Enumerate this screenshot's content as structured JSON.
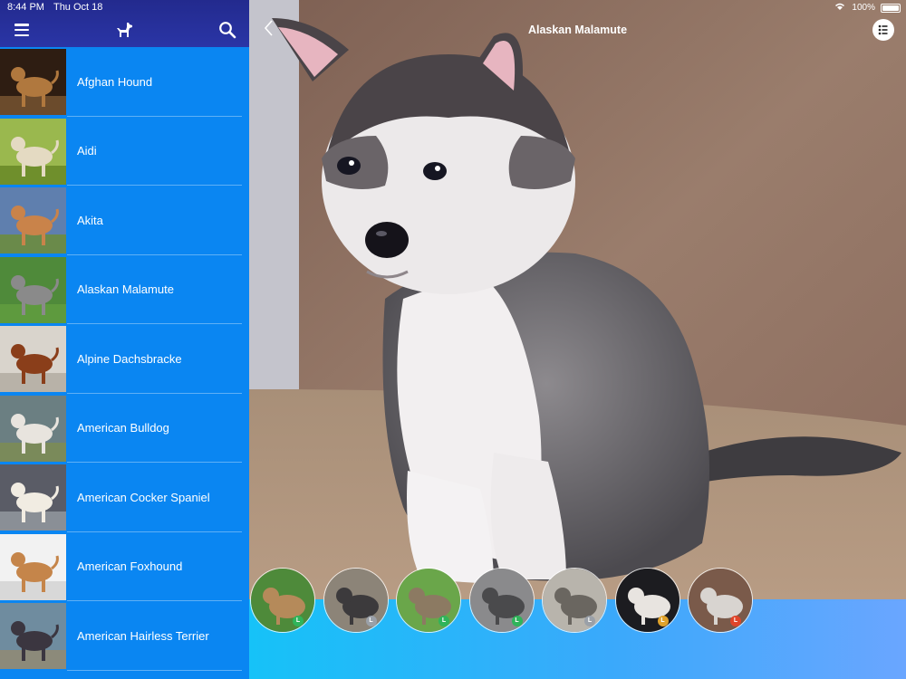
{
  "status": {
    "time": "8:44 PM",
    "date": "Thu Oct 18",
    "battery": "100%"
  },
  "detail": {
    "title": "Alaskan Malamute",
    "back_glyph": "<"
  },
  "breeds": [
    {
      "name": "Afghan Hound",
      "coat": "#b0783e",
      "bg": "#2e1d12",
      "grass": "#6b4b2c"
    },
    {
      "name": "Aidi",
      "coat": "#e4dac2",
      "bg": "#9ab84e",
      "grass": "#6f8f2c"
    },
    {
      "name": "Akita",
      "coat": "#c9834a",
      "bg": "#5f7fae",
      "grass": "#6a8a4a"
    },
    {
      "name": "Alaskan Malamute",
      "coat": "#8a8a8a",
      "bg": "#4f8a3a",
      "grass": "#5e9a3e"
    },
    {
      "name": "Alpine Dachsbracke",
      "coat": "#8a3e1a",
      "bg": "#d9d4cc",
      "grass": "#b8b2a8"
    },
    {
      "name": "American Bulldog",
      "coat": "#e8e4de",
      "bg": "#6b7f82",
      "grass": "#7a8a5a"
    },
    {
      "name": "American Cocker Spaniel",
      "coat": "#f1ece2",
      "bg": "#5a5c66",
      "grass": "#8a8f96"
    },
    {
      "name": "American Foxhound",
      "coat": "#c5854a",
      "bg": "#f2f2f2",
      "grass": "#d8d8d8"
    },
    {
      "name": "American Hairless Terrier",
      "coat": "#3b3640",
      "bg": "#6f8c9f",
      "grass": "#8c8a7a"
    }
  ],
  "gallery": [
    {
      "badge": "L",
      "badge_color": "#2fb45a",
      "bg": "#4e8a3a",
      "fur": "#b58a5a"
    },
    {
      "badge": "L",
      "badge_color": "#9aa0a8",
      "bg": "#8c8478",
      "fur": "#3c3a3c"
    },
    {
      "badge": "L",
      "badge_color": "#2fb45a",
      "bg": "#6aa64a",
      "fur": "#8c7a62"
    },
    {
      "badge": "L",
      "badge_color": "#2fb45a",
      "bg": "#8a8a8c",
      "fur": "#4a4a4c"
    },
    {
      "badge": "L",
      "badge_color": "#9aa0a8",
      "bg": "#b8b4ac",
      "fur": "#6a6660"
    },
    {
      "badge": "L",
      "badge_color": "#e0a22a",
      "bg": "#1c1c20",
      "fur": "#e8e4e0"
    },
    {
      "badge": "L",
      "badge_color": "#e0452a",
      "bg": "#7a5a4a",
      "fur": "#d8d4d0"
    }
  ],
  "colors": {
    "sidebar": "#0a86f2",
    "header": "#2a35a6",
    "bottom_bar": "#3aa9fb"
  }
}
